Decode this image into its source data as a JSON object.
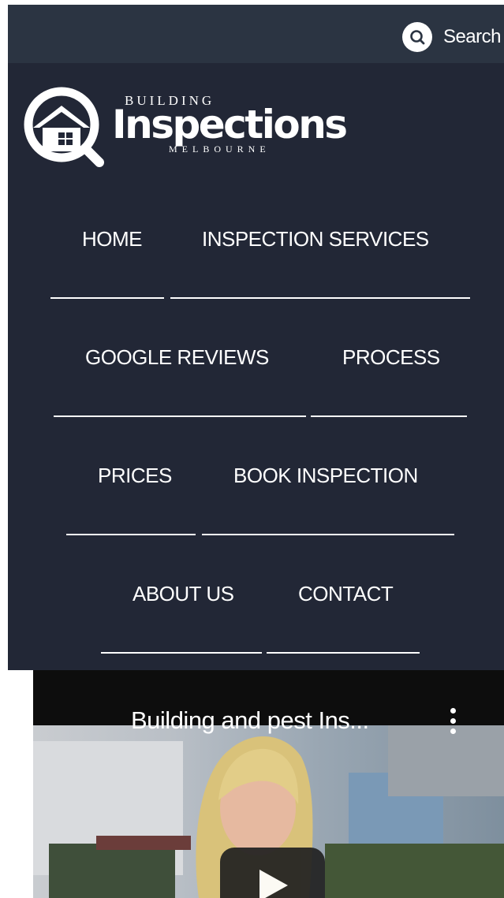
{
  "topbar": {
    "search_label": "Search"
  },
  "logo": {
    "top": "BUILDING",
    "main": "Inspections",
    "bottom": "MELBOURNE"
  },
  "nav": {
    "home": "HOME",
    "inspection_services": "INSPECTION SERVICES",
    "google_reviews": "GOOGLE REVIEWS",
    "process": "PROCESS",
    "prices": "PRICES",
    "book_inspection": "BOOK INSPECTION",
    "about_us": "ABOUT US",
    "contact": "CONTACT"
  },
  "video": {
    "title": "Building and pest Ins..."
  },
  "colors": {
    "topbar": "#2b3442",
    "header": "#222736",
    "text": "#ffffff"
  },
  "icons": {
    "search": "search-icon",
    "more": "more-vert-icon",
    "play": "play-icon"
  }
}
